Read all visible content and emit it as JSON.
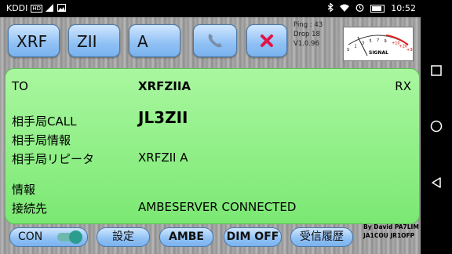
{
  "status_bar": {
    "carrier": "KDDI",
    "hd_badge": "HD",
    "time": "10:52",
    "icons": [
      "signal-icon",
      "image-icon",
      "bluetooth-icon",
      "wifi-icon",
      "alarm-icon",
      "battery-icon"
    ]
  },
  "toolbar": {
    "field1": "XRF",
    "field2": "ZII",
    "field3": "A",
    "call_icon": "phone-icon",
    "cancel_icon": "close-icon",
    "ping_label": "Ping : 43",
    "drop_label": "Drop 18",
    "version": "V1.0.96",
    "meter_label": "SIGNAL",
    "meter_scale": [
      "S",
      "1",
      "3",
      "5",
      "7",
      "9",
      "+10",
      "+20",
      "+30"
    ]
  },
  "panel": {
    "to_label": "TO",
    "to_value": "XRFZIIA",
    "mode": "RX",
    "call_label": "相手局CALL",
    "call_value": "JL3ZII",
    "info_label": "相手局情報",
    "info_value": "",
    "repeater_label": "相手局リピータ",
    "repeater_value": "XRFZII A",
    "message_label": "情報",
    "message_value": "",
    "connect_label": "接続先",
    "connect_value": "AMBESERVER CONNECTED"
  },
  "bottom_bar": {
    "con_label": "CON",
    "con_on": true,
    "settings_label": "設定",
    "ambe_label": "AMBE",
    "dim_label": "DIM OFF",
    "history_label": "受信履歴",
    "credit_line1": "By David PA7LIM",
    "credit_line2": "JA1COU JR1OFP"
  },
  "colors": {
    "panel_green": "#8cef84",
    "button_blue": "#8fc0f4",
    "cancel_red": "#e0144a",
    "toggle_teal": "#2a9d8f"
  }
}
